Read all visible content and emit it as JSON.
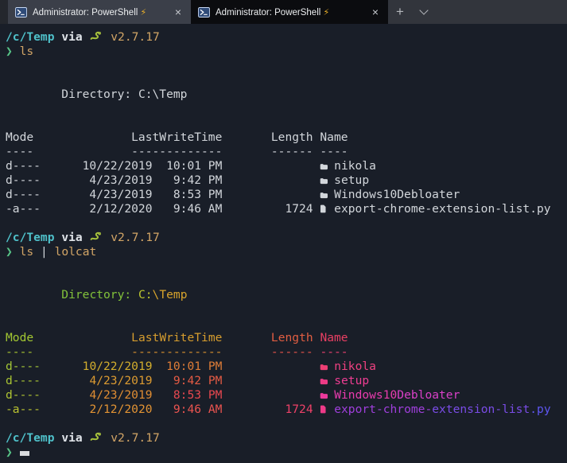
{
  "tabbar": {
    "close_label": "×",
    "new_tab_label": "+",
    "tabs": [
      {
        "title": "Administrator: PowerShell",
        "bolt": "⚡",
        "active": false
      },
      {
        "title": "Administrator: PowerShell",
        "bolt": "⚡",
        "active": true
      }
    ]
  },
  "colors": {
    "terminal_bg": "#191e28",
    "foreground": "#d2d6db",
    "cwd_cyan": "#4fc1ca",
    "prompt_green": "#57c487",
    "command_amber": "#d2a566",
    "bolt_yellow": "#f0b429"
  },
  "terminal": {
    "lines": [
      [
        {
          "t": "/c/Temp",
          "c": "#4fc1ca",
          "b": true,
          "n": "cwd"
        },
        {
          "t": " "
        },
        {
          "t": "via",
          "c": "#dfe3e8",
          "b": true,
          "n": "via-label"
        },
        {
          "t": " "
        },
        {
          "icon": "snake",
          "c": "#a6c03c"
        },
        {
          "t": " "
        },
        {
          "t": "v2.7.17",
          "c": "#d2a566",
          "n": "python-version"
        }
      ],
      [
        {
          "t": "❯",
          "c": "#57c487",
          "n": "prompt-symbol"
        },
        {
          "t": " "
        },
        {
          "t": "ls",
          "c": "#d2a566",
          "n": "command"
        }
      ],
      [],
      [],
      [
        {
          "t": "        "
        },
        {
          "t": "Directory: C:\\Temp",
          "c": "#d2d6db",
          "n": "directory-path"
        }
      ],
      [],
      [],
      [
        {
          "t": "Mode              LastWriteTime       Length Name",
          "c": "#d2d6db",
          "n": "table-header"
        }
      ],
      [
        {
          "t": "----              -------------       ------ ----",
          "c": "#d2d6db",
          "n": "table-header-underline"
        }
      ],
      [
        {
          "t": "d----      10/22/2019  10:01 PM              ",
          "c": "#d2d6db",
          "n": "row-fields"
        },
        {
          "icon": "folder",
          "c": "#d2d6db"
        },
        {
          "t": " nikola",
          "c": "#d2d6db",
          "n": "dir-name"
        }
      ],
      [
        {
          "t": "d----       4/23/2019   9:42 PM              ",
          "c": "#d2d6db",
          "n": "row-fields"
        },
        {
          "icon": "folder",
          "c": "#d2d6db"
        },
        {
          "t": " setup",
          "c": "#d2d6db",
          "n": "dir-name"
        }
      ],
      [
        {
          "t": "d----       4/23/2019   8:53 PM              ",
          "c": "#d2d6db",
          "n": "row-fields"
        },
        {
          "icon": "folder",
          "c": "#d2d6db"
        },
        {
          "t": " Windows10Debloater",
          "c": "#d2d6db",
          "n": "dir-name"
        }
      ],
      [
        {
          "t": "-a---       2/12/2020   9:46 AM         1724 ",
          "c": "#d2d6db",
          "n": "row-fields"
        },
        {
          "icon": "file",
          "c": "#d2d6db"
        },
        {
          "t": " export-chrome-extension-list.py",
          "c": "#d2d6db",
          "n": "file-name"
        }
      ],
      [],
      [
        {
          "t": "/c/Temp",
          "c": "#4fc1ca",
          "b": true,
          "n": "cwd"
        },
        {
          "t": " "
        },
        {
          "t": "via",
          "c": "#dfe3e8",
          "b": true,
          "n": "via-label"
        },
        {
          "t": " "
        },
        {
          "icon": "snake",
          "c": "#a6c03c"
        },
        {
          "t": " "
        },
        {
          "t": "v2.7.17",
          "c": "#d2a566",
          "n": "python-version"
        }
      ],
      [
        {
          "t": "❯",
          "c": "#57c487",
          "n": "prompt-symbol"
        },
        {
          "t": " "
        },
        {
          "t": "ls",
          "c": "#d2a566",
          "n": "command"
        },
        {
          "t": " "
        },
        {
          "t": "|",
          "c": "#d2d6db",
          "n": "pipe"
        },
        {
          "t": " "
        },
        {
          "t": "lolcat",
          "c": "#d2a566",
          "n": "command"
        }
      ],
      [],
      [],
      [
        {
          "t": "        "
        },
        {
          "t": "Directory:",
          "c": "#82c23a",
          "n": "directory-label"
        },
        {
          "t": " "
        },
        {
          "t": "C:",
          "c": "#bdc72f",
          "n": "directory-path"
        },
        {
          "t": "\\Temp",
          "c": "#d8a42c",
          "n": "directory-path"
        }
      ],
      [],
      [],
      [
        {
          "t": "Mode",
          "c": "#a3c832",
          "n": "col-mode"
        },
        {
          "t": "              "
        },
        {
          "t": "LastWriteTime",
          "c": "#d69d2e",
          "n": "col-lastwritetime"
        },
        {
          "t": "       "
        },
        {
          "t": "Length",
          "c": "#e25e42",
          "n": "col-length"
        },
        {
          "t": " "
        },
        {
          "t": "Name",
          "c": "#e93f63",
          "n": "col-name"
        }
      ],
      [
        {
          "t": "----",
          "c": "#a8c530"
        },
        {
          "t": "              "
        },
        {
          "t": "-------------",
          "c": "#d9922f"
        },
        {
          "t": "       "
        },
        {
          "t": "------",
          "c": "#e6544a"
        },
        {
          "t": " "
        },
        {
          "t": "----",
          "c": "#ec4170"
        }
      ],
      [
        {
          "t": "d----",
          "c": "#a3c636",
          "n": "mode"
        },
        {
          "t": "      "
        },
        {
          "t": "10/22/2019",
          "c": "#d3ae2d",
          "n": "date"
        },
        {
          "t": "  "
        },
        {
          "t": "10:01 PM",
          "c": "#df7d37",
          "n": "time"
        },
        {
          "t": "              "
        },
        {
          "icon": "folder",
          "c": "#ed3f74"
        },
        {
          "t": " "
        },
        {
          "t": "nikola",
          "c": "#ef4180",
          "n": "dir-name"
        }
      ],
      [
        {
          "t": "d----",
          "c": "#a9c533",
          "n": "mode"
        },
        {
          "t": "       "
        },
        {
          "t": "4/23/2019",
          "c": "#dc9b31",
          "n": "date"
        },
        {
          "t": "   "
        },
        {
          "t": "9:42 PM",
          "c": "#e55b44",
          "n": "time"
        },
        {
          "t": "              "
        },
        {
          "icon": "folder",
          "c": "#ee3b86"
        },
        {
          "t": " "
        },
        {
          "t": "setup",
          "c": "#ef3d93",
          "n": "dir-name"
        }
      ],
      [
        {
          "t": "d----",
          "c": "#afc432",
          "n": "mode"
        },
        {
          "t": "       "
        },
        {
          "t": "4/23/2019",
          "c": "#e08d33",
          "n": "date"
        },
        {
          "t": "   "
        },
        {
          "t": "8:53 PM",
          "c": "#e94850",
          "n": "time"
        },
        {
          "t": "              "
        },
        {
          "icon": "folder",
          "c": "#ec3a9c"
        },
        {
          "t": " "
        },
        {
          "t": "Windows10",
          "c": "#e93bae",
          "n": "dir-name"
        },
        {
          "t": "Debloater",
          "c": "#da40c8",
          "n": "dir-name"
        }
      ],
      [
        {
          "t": "-a---",
          "c": "#b9c231",
          "n": "mode"
        },
        {
          "t": "       "
        },
        {
          "t": "2/12/2020",
          "c": "#e39434",
          "n": "date"
        },
        {
          "t": "   "
        },
        {
          "t": "9:46 AM",
          "c": "#eb5450",
          "n": "time"
        },
        {
          "t": "         "
        },
        {
          "t": "1724",
          "c": "#ed4168",
          "n": "size"
        },
        {
          "t": " "
        },
        {
          "icon": "file",
          "c": "#ee3a88"
        },
        {
          "t": " "
        },
        {
          "t": "export-chrome-",
          "c": "#a03fdd",
          "n": "file-name"
        },
        {
          "t": "extension-list",
          "c": "#7a4ce7",
          "n": "file-name"
        },
        {
          "t": ".py",
          "c": "#5e56f1",
          "n": "file-name"
        }
      ],
      [],
      [
        {
          "t": "/c/Temp",
          "c": "#4fc1ca",
          "b": true,
          "n": "cwd"
        },
        {
          "t": " "
        },
        {
          "t": "via",
          "c": "#dfe3e8",
          "b": true,
          "n": "via-label"
        },
        {
          "t": " "
        },
        {
          "icon": "snake",
          "c": "#a6c03c"
        },
        {
          "t": " "
        },
        {
          "t": "v2.7.17",
          "c": "#d2a566",
          "n": "python-version"
        }
      ],
      [
        {
          "t": "❯",
          "c": "#57c487",
          "n": "prompt-symbol"
        },
        {
          "t": " "
        },
        {
          "cursor": true
        }
      ]
    ]
  }
}
